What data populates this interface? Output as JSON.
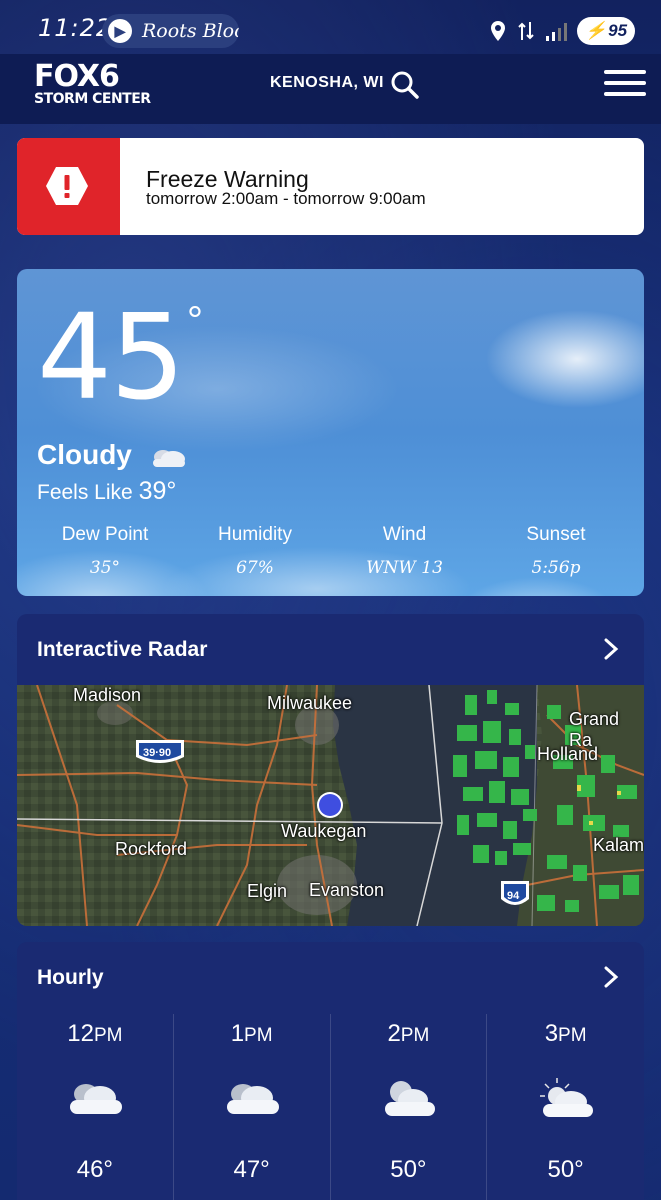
{
  "status_bar": {
    "time": "11:22",
    "notification_app": "Roots Bloo",
    "battery": "95"
  },
  "header": {
    "logo_main": "FOX6",
    "logo_sub": "STORM CENTER",
    "location": "KENOSHA, WI"
  },
  "alert": {
    "title": "Freeze Warning",
    "time": "tomorrow 2:00am - tomorrow 9:00am"
  },
  "current": {
    "temperature": "45",
    "degree": "°",
    "condition": "Cloudy",
    "feels_like_label": "Feels Like",
    "feels_like_value": "39°",
    "stats": [
      {
        "label": "Dew Point",
        "value": "35°"
      },
      {
        "label": "Humidity",
        "value": "67%"
      },
      {
        "label": "Wind",
        "value": "WNW 13"
      },
      {
        "label": "Sunset",
        "value": "5:56p"
      }
    ]
  },
  "radar": {
    "title": "Interactive Radar",
    "cities": {
      "madison": "Madison",
      "milwaukee": "Milwaukee",
      "grand_rapids": "Grand Ra",
      "holland": "Holland",
      "waukegan": "Waukegan",
      "rockford": "Rockford",
      "kalamazoo": "Kalam",
      "elgin": "Elgin",
      "evanston": "Evanston"
    },
    "highways": {
      "i39_90": "39·90",
      "i94": "94"
    }
  },
  "hourly": {
    "title": "Hourly",
    "items": [
      {
        "hour": "12",
        "ampm": "PM",
        "temp": "46°",
        "icon": "cloudy-icon"
      },
      {
        "hour": "1",
        "ampm": "PM",
        "temp": "47°",
        "icon": "cloudy-icon"
      },
      {
        "hour": "2",
        "ampm": "PM",
        "temp": "50°",
        "icon": "partly-cloudy-icon"
      },
      {
        "hour": "3",
        "ampm": "PM",
        "temp": "50°",
        "icon": "mostly-cloudy-sun-icon"
      }
    ]
  },
  "colors": {
    "background": "#12225f",
    "alert_red": "#e0242a",
    "card_blue": "#1a2a72",
    "sky_blue": "#4e8fd6"
  }
}
